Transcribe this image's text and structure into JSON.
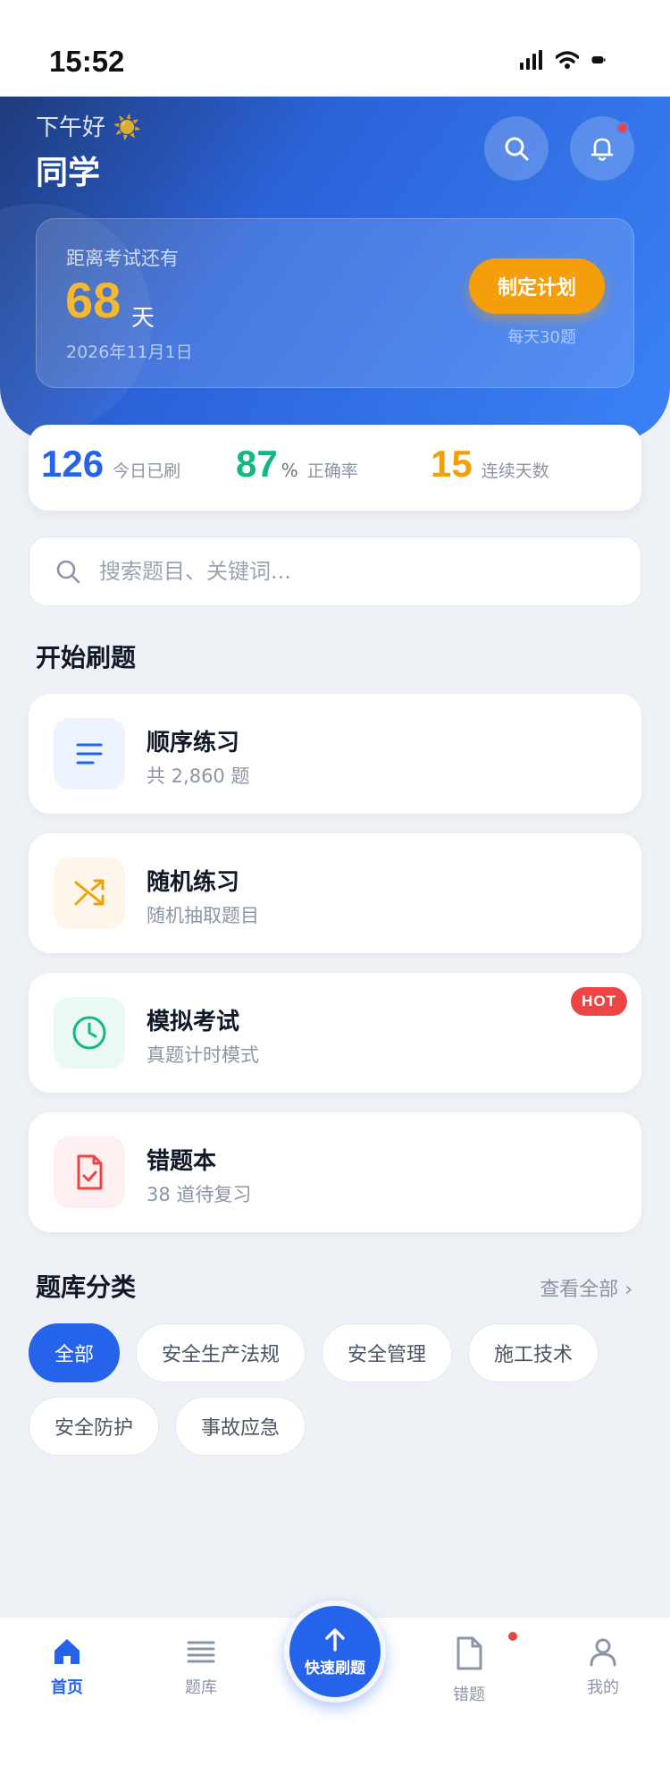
{
  "status_bar": {
    "time": "15:52"
  },
  "header": {
    "greeting": "下午好 ☀️",
    "name": "同学",
    "exam": {
      "label": "距离考试还有",
      "days": "68",
      "unit": "天",
      "date": "2026年11月1日",
      "plan_button": "制定计划",
      "plan_sub": "每天30题"
    }
  },
  "stats": [
    {
      "value": "126",
      "suffix": "",
      "label": "今日已刷",
      "color": "#2563eb"
    },
    {
      "value": "87",
      "suffix": "%",
      "label": "正确率",
      "color": "#10b981"
    },
    {
      "value": "15",
      "suffix": "",
      "label": "连续天数",
      "color": "#f59e0b"
    }
  ],
  "search": {
    "placeholder": "搜索题目、关键词..."
  },
  "practice": {
    "title": "开始刷题",
    "items": [
      {
        "title": "顺序练习",
        "subtitle": "共 2,860 题",
        "icon": "list-icon",
        "color": "#2563eb"
      },
      {
        "title": "随机练习",
        "subtitle": "随机抽取题目",
        "icon": "shuffle-icon",
        "color": "#f59e0b"
      },
      {
        "title": "模拟考试",
        "subtitle": "真题计时模式",
        "icon": "clock-icon",
        "color": "#10b981",
        "badge": "HOT"
      },
      {
        "title": "错题本",
        "subtitle": "38 道待复习",
        "icon": "document-check-icon",
        "color": "#ef4444"
      }
    ]
  },
  "categories": {
    "title": "题库分类",
    "view_all": "查看全部 ›",
    "chips": [
      "全部",
      "安全生产法规",
      "安全管理",
      "施工技术",
      "安全防护",
      "事故应急"
    ],
    "active": "全部"
  },
  "tab_bar": {
    "items": [
      {
        "label": "首页",
        "icon": "home-icon",
        "active": true
      },
      {
        "label": "题库",
        "icon": "menu-icon"
      },
      {
        "label": "快速刷题",
        "icon": "arrow-up-icon"
      },
      {
        "label": "错题",
        "icon": "document-icon",
        "dot": true
      },
      {
        "label": "我的",
        "icon": "user-icon"
      }
    ]
  }
}
